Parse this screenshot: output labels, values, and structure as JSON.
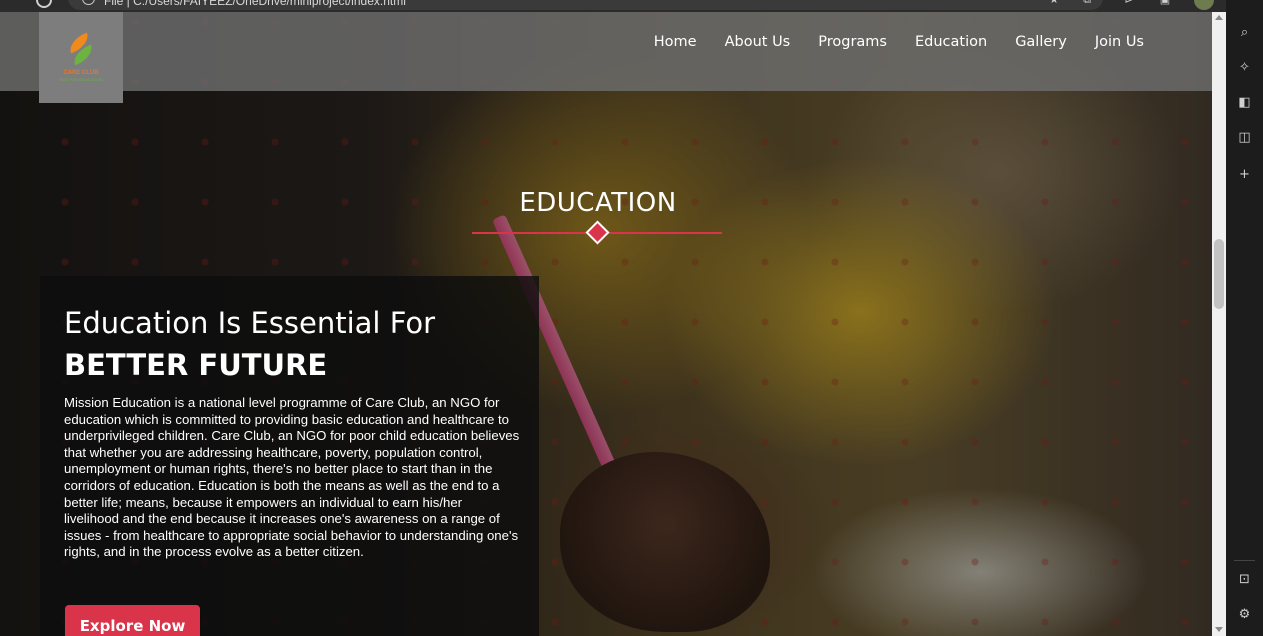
{
  "browser": {
    "url_text": "File  |  C:/Users/FAIYEEZ/OneDrive/miniproject/index.html",
    "icons": [
      "back-icon",
      "info-icon",
      "favorites-icon",
      "collections-icon",
      "profile-avatar"
    ]
  },
  "header": {
    "logo_text": "CARE CLUB",
    "logo_subtext": "NGO FOR EDUCATION",
    "nav": [
      {
        "label": "Home"
      },
      {
        "label": "About Us"
      },
      {
        "label": "Programs"
      },
      {
        "label": "Education"
      },
      {
        "label": "Gallery"
      },
      {
        "label": "Join Us"
      }
    ]
  },
  "hero": {
    "section_title": "EDUCATION",
    "heading_light": "Education Is Essential For",
    "heading_bold": "BETTER FUTURE",
    "body": "Mission Education is a national level programme of Care Club, an NGO for education which is committed to providing basic education and healthcare to underprivileged children. Care Club, an NGO for poor child education believes that whether you are addressing healthcare, poverty, population control, unemployment or human rights, there's no better place to start than in the corridors of education. Education is both the means as well as the end to a better life; means, because it empowers an individual to earn his/her livelihood and the end because it increases one's awareness on a range of issues - from healthcare to appropriate social behavior to understanding one's rights, and in the process evolve as a better citizen.",
    "button_label": "Explore Now"
  },
  "colors": {
    "accent": "#d9344a",
    "header_bg": "#6e6e6e",
    "panel_bg": "#0e0e0e"
  },
  "sidebar_icons": [
    "search-icon",
    "sparkle-icon",
    "office-icon",
    "outlook-icon",
    "add-icon",
    "sidebar-toggle-icon",
    "settings-icon"
  ]
}
